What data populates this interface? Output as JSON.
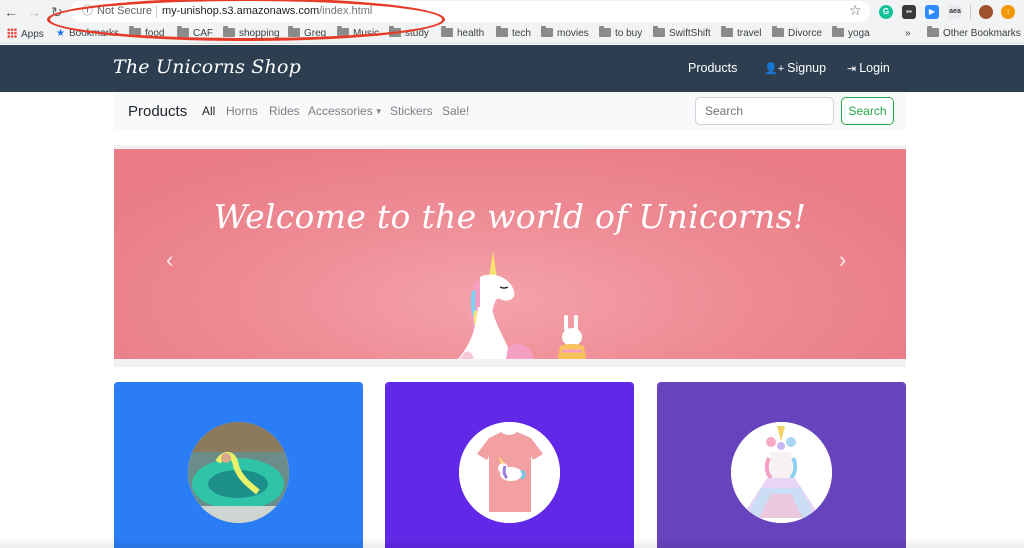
{
  "browser": {
    "security_label": "Not Secure",
    "url_host": "my-unishop.s3.amazonaws.com",
    "url_path": "/index.html",
    "extensions": [
      {
        "name": "grammarly-icon",
        "glyph": "G"
      },
      {
        "name": "dark-extension-icon",
        "glyph": "▪▪"
      },
      {
        "name": "zoom-icon",
        "glyph": "▶"
      },
      {
        "name": "aea-extension-icon",
        "glyph": "aea"
      },
      {
        "name": "profile-avatar",
        "glyph": ""
      },
      {
        "name": "update-icon",
        "glyph": "↑"
      }
    ]
  },
  "bookmarks": {
    "apps_label": "Apps",
    "bookmarks_label": "Bookmarks",
    "items": [
      "food",
      "CAF",
      "shopping",
      "Greg",
      "Music",
      "study",
      "health",
      "tech",
      "movies",
      "to buy",
      "SwiftShift",
      "travel",
      "Divorce",
      "yoga"
    ],
    "overflow": "»",
    "other_label": "Other Bookmarks"
  },
  "navbar": {
    "brand": "The Unicorns Shop",
    "links": {
      "products": "Products",
      "signup": "Signup",
      "login": "Login"
    }
  },
  "catbar": {
    "title": "Products",
    "links": [
      "All",
      "Horns",
      "Rides",
      "Accessories",
      "Stickers",
      "Sale!"
    ],
    "search_placeholder": "Search",
    "search_button": "Search"
  },
  "carousel": {
    "headline": "Welcome to the world of Unicorns!",
    "prev_glyph": "‹",
    "next_glyph": "›",
    "slide_count": 2,
    "active_slide": 2
  },
  "colors": {
    "navbar": "#2c3e50",
    "carousel": "#ee8c95",
    "card_1": "#2a7df4",
    "card_2": "#6228e8",
    "card_3": "#6843be",
    "search_button": "#28a745",
    "url_highlight": "#e63b27"
  }
}
